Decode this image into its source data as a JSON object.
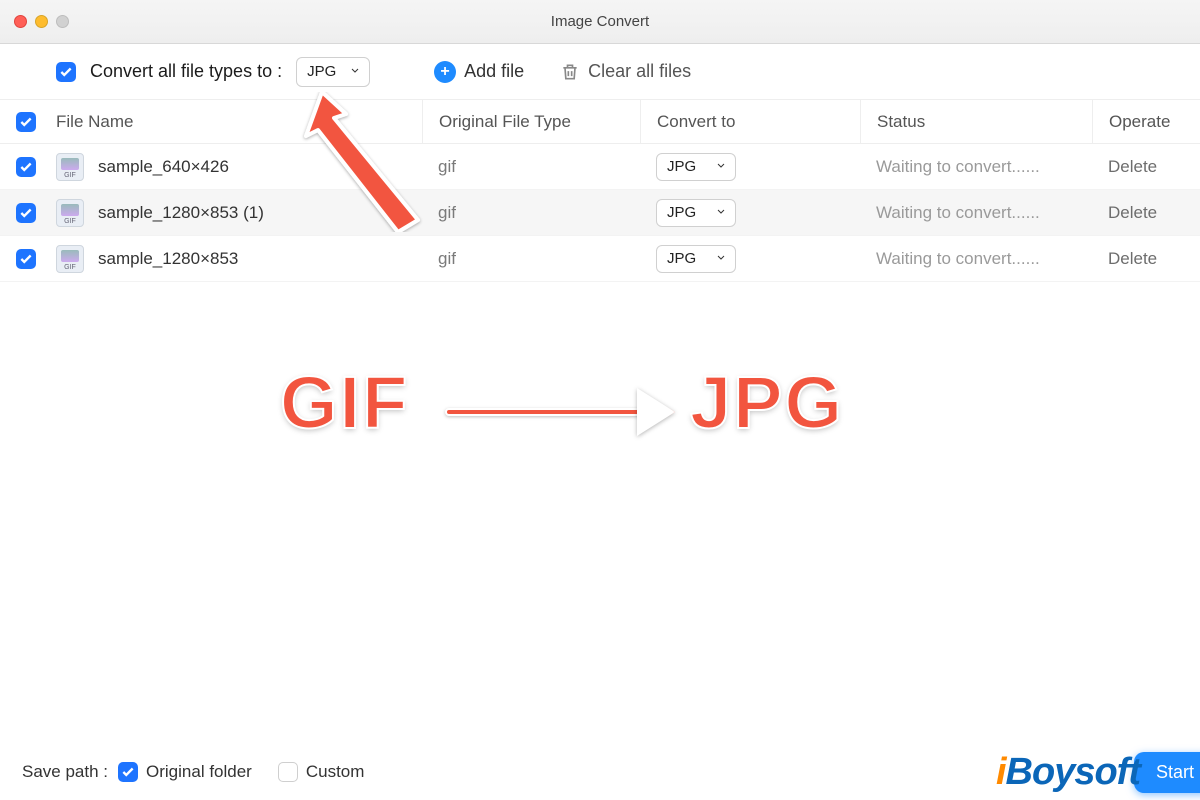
{
  "window": {
    "title": "Image Convert"
  },
  "toolbar": {
    "convert_all_label": "Convert all file types to :",
    "format_selected": "JPG",
    "add_file_label": "Add file",
    "clear_all_label": "Clear all files"
  },
  "columns": {
    "name": "File Name",
    "original": "Original File Type",
    "convert_to": "Convert to",
    "status": "Status",
    "operate": "Operate"
  },
  "rows": [
    {
      "name": "sample_640×426",
      "original": "gif",
      "convert_to": "JPG",
      "status": "Waiting to convert......",
      "operate": "Delete"
    },
    {
      "name": "sample_1280×853 (1)",
      "original": "gif",
      "convert_to": "JPG",
      "status": "Waiting to convert......",
      "operate": "Delete"
    },
    {
      "name": "sample_1280×853",
      "original": "gif",
      "convert_to": "JPG",
      "status": "Waiting to convert......",
      "operate": "Delete"
    }
  ],
  "annotation": {
    "left_text": "GIF",
    "right_text": "JPG"
  },
  "footer": {
    "save_path_label": "Save path :",
    "original_folder": "Original folder",
    "custom": "Custom",
    "start": "Start"
  },
  "brand": "iBoysoft",
  "icons": {
    "file_badge": "GIF"
  },
  "colors": {
    "accent": "#1e8bff",
    "annotation": "#f2553f",
    "brand": "#0b66b8"
  }
}
